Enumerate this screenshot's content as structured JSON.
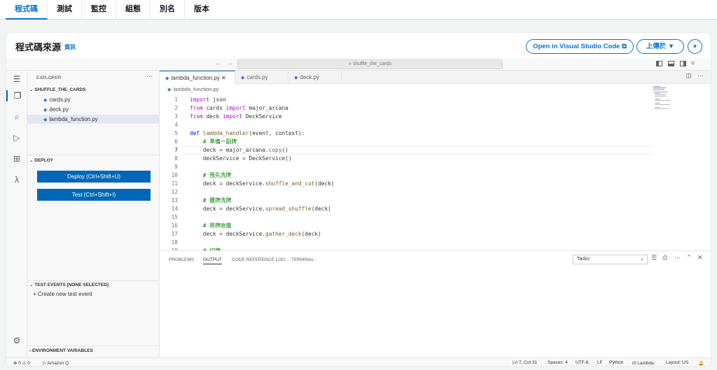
{
  "top_tabs": [
    "程式碼",
    "測試",
    "監控",
    "組態",
    "別名",
    "版本"
  ],
  "panel": {
    "title": "程式碼來源",
    "info": "資訊",
    "open_vscode": "Open in Visual Studio Code",
    "upload": "上傳於 ▼",
    "more": "▼"
  },
  "ide": {
    "command_center": "shuffle_the_cards",
    "explorer": {
      "header": "EXPLORER",
      "folder": "SHUFFLE_THE_CARDS",
      "files": [
        "cards.py",
        "deck.py",
        "lambda_function.py"
      ],
      "selected_file": "lambda_function.py"
    },
    "deploy": {
      "header": "DEPLOY",
      "deploy_btn": "Deploy (Ctrl+Shift+U)",
      "test_btn": "Test (Ctrl+Shift+I)"
    },
    "test_events": {
      "header": "TEST EVENTS [NONE SELECTED]",
      "create": "Create new test event"
    },
    "env": {
      "header": "ENVIRONMENT VARIABLES"
    },
    "editor_tabs": [
      "lambda_function.py",
      "cards.py",
      "deck.py"
    ],
    "breadcrumb": "lambda_function.py",
    "code": [
      {
        "n": "1",
        "t": "import json"
      },
      {
        "n": "2",
        "t": "from cards import major_arcana"
      },
      {
        "n": "3",
        "t": "from deck import DeckService"
      },
      {
        "n": "4",
        "t": ""
      },
      {
        "n": "5",
        "t": "def lambda_handler(event, context):"
      },
      {
        "n": "6",
        "t": "    # 準備一副牌"
      },
      {
        "n": "7",
        "t": "    deck = major_arcana.copy()"
      },
      {
        "n": "8",
        "t": "    deckService = DeckService()"
      },
      {
        "n": "9",
        "t": ""
      },
      {
        "n": "10",
        "t": "    # 預先洗牌"
      },
      {
        "n": "11",
        "t": "    deck = deckService.shuffle_and_cut(deck)"
      },
      {
        "n": "12",
        "t": ""
      },
      {
        "n": "13",
        "t": "    # 攤牌洗牌"
      },
      {
        "n": "14",
        "t": "    deck = deckService.spread_shuffle(deck)"
      },
      {
        "n": "15",
        "t": ""
      },
      {
        "n": "16",
        "t": "    # 將牌收攏"
      },
      {
        "n": "17",
        "t": "    deck = deckService.gather_deck(deck)"
      },
      {
        "n": "18",
        "t": ""
      },
      {
        "n": "19",
        "t": "    # 切牌"
      }
    ],
    "output_tabs": [
      "PROBLEMS",
      "OUTPUT",
      "CODE REFERENCE LOG",
      "TERMINAL"
    ],
    "output_select": "Tasks",
    "status": {
      "errors": "⊗ 0 ⚠ 0",
      "amazonq": "▷ Amazon Q",
      "pos": "Ln 7, Col 31",
      "spaces": "Spaces: 4",
      "enc": "UTF-8",
      "eol": "LF",
      "lang": "Python",
      "lambda": "Lambda",
      "layout": "Layout: US"
    }
  }
}
